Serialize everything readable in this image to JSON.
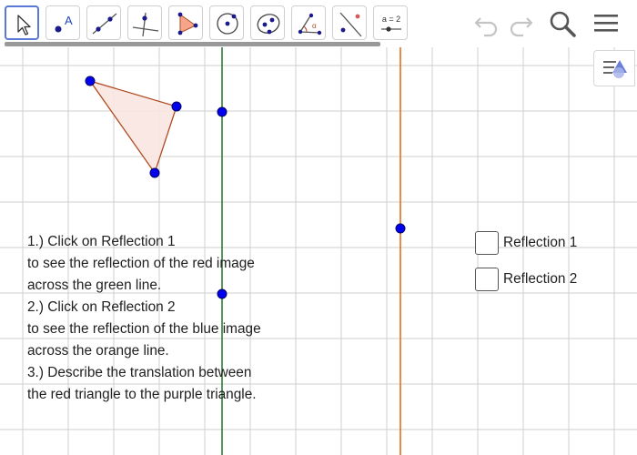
{
  "toolbar": {
    "tools": [
      {
        "name": "move-tool",
        "icon": "arrow-pointer-icon",
        "selected": true
      },
      {
        "name": "point-tool",
        "icon": "point-icon",
        "glyph": "A"
      },
      {
        "name": "line-tool",
        "icon": "line-through-points-icon"
      },
      {
        "name": "perpendicular-line-tool",
        "icon": "perpendicular-line-icon"
      },
      {
        "name": "polygon-tool",
        "icon": "polygon-icon"
      },
      {
        "name": "circle-tool",
        "icon": "circle-center-point-icon"
      },
      {
        "name": "ellipse-tool",
        "icon": "ellipse-icon"
      },
      {
        "name": "angle-tool",
        "icon": "angle-icon",
        "glyph": "α"
      },
      {
        "name": "reflect-tool",
        "icon": "reflect-about-line-icon"
      },
      {
        "name": "slider-tool",
        "icon": "slider-icon",
        "glyph": "a = 2"
      }
    ],
    "undo_icon": "undo-icon",
    "redo_icon": "redo-icon",
    "search_icon": "search-icon",
    "menu_icon": "hamburger-menu-icon"
  },
  "graphics": {
    "style_bar_icon": "style-bar-toggle-icon",
    "colors": {
      "grid": "#c8c8c8",
      "green_line": "#2e7d32",
      "orange_line": "#e07020",
      "triangle_stroke": "#b04a22",
      "triangle_fill": "#f8e6e0",
      "point": "#0000ee"
    }
  },
  "instructions": {
    "lines": [
      "1.) Click on Reflection 1",
      "to see the reflection of the red image",
      "across the green line.",
      "2.) Click on Reflection 2",
      "to see the reflection of the blue image",
      "across the orange line.",
      "3.) Describe the translation between",
      "the red triangle to the purple triangle."
    ]
  },
  "checkboxes": [
    {
      "label": "Reflection 1",
      "checked": false
    },
    {
      "label": "Reflection 2",
      "checked": false
    }
  ]
}
